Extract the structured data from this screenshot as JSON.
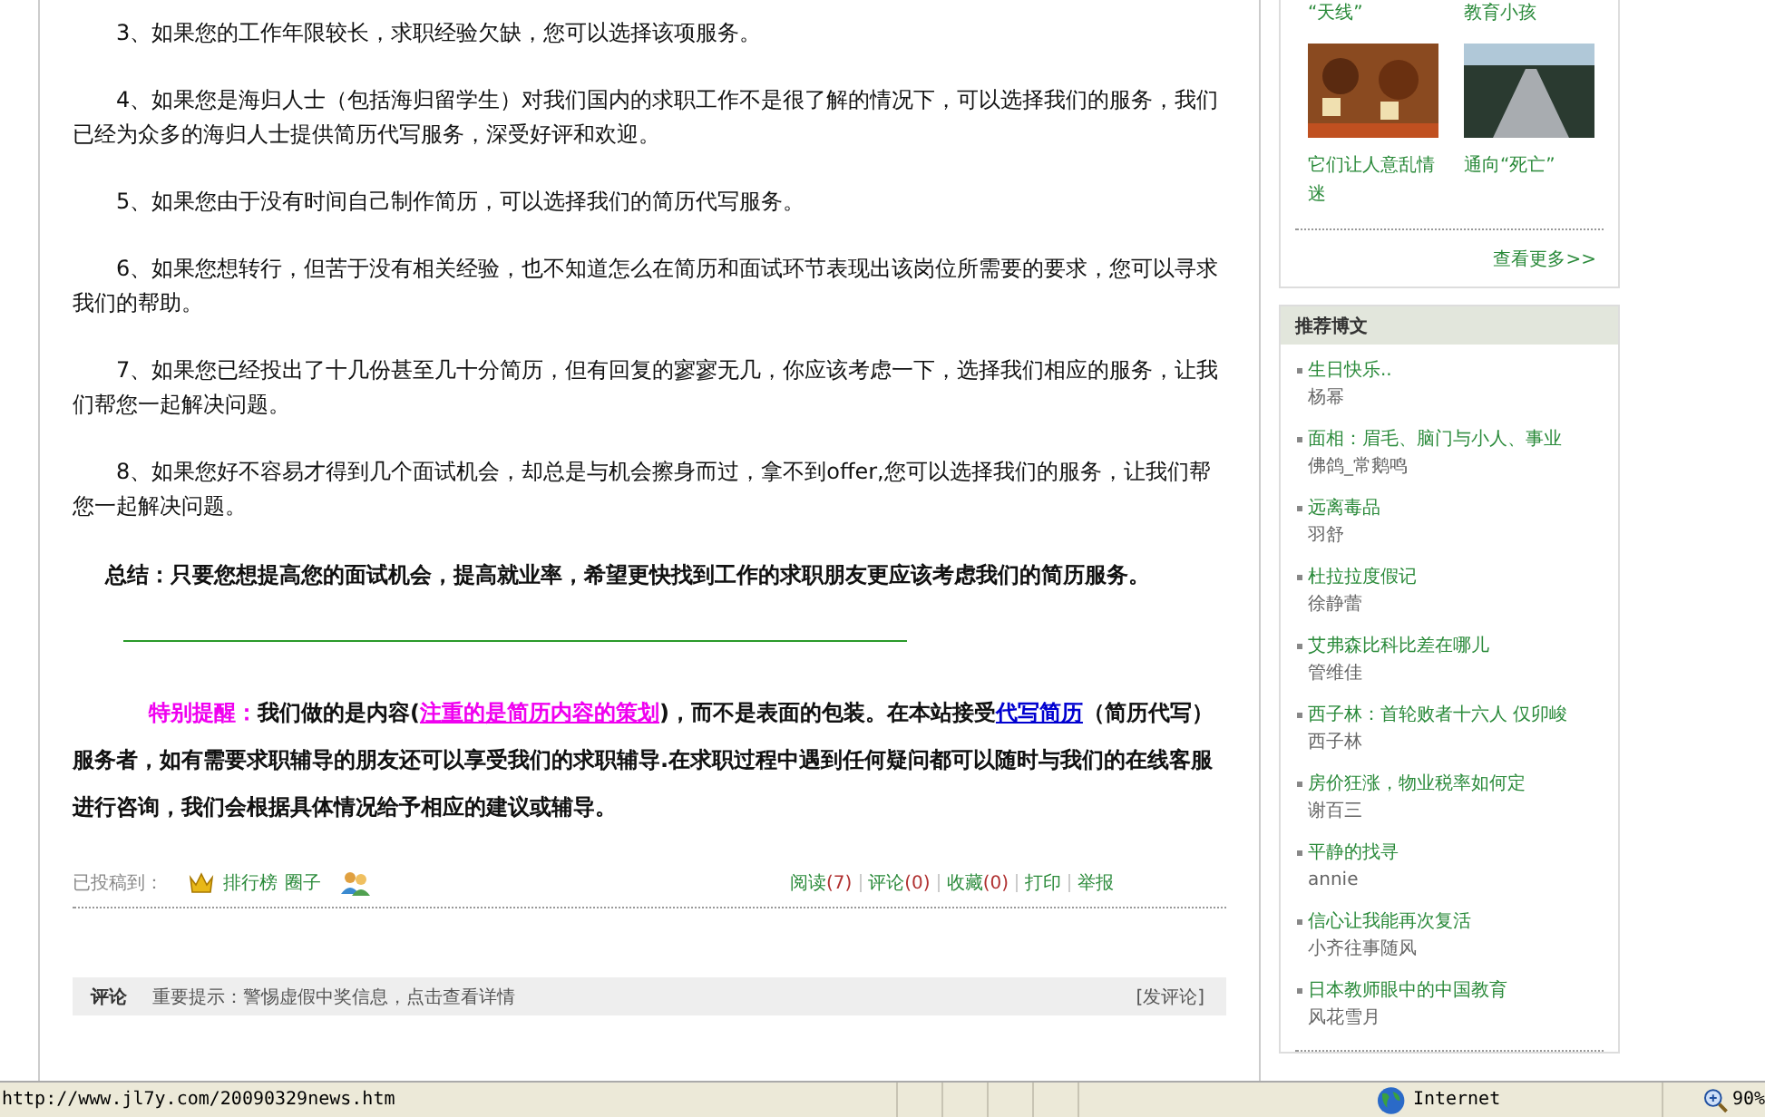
{
  "article": {
    "paragraphs": [
      [
        "3、如果您的工作年限较长，求职经验欠缺，您可以选择该项服务。"
      ],
      [
        "4、如果您是海归人士（包括海归留学生）对我们国内的求职工作不是很了解的情况下，可以选择我们的服务，我们已经为众多的海归人士提供简历代写服务，深受好评和欢迎。"
      ],
      [
        "5、如果您由于没有时间自己制作简历，可以选择我们的简历代写服务。"
      ],
      [
        "6、如果您想转行，但苦于没有相关经验，也不知道怎么在简历和面试环节表现出该岗位所需要的要求，您可以寻求我们的帮助。"
      ],
      [
        "7、如果您已经投出了十几份甚至几十分简历，但有回复的寥寥无几，你应该考虑一下，选择我们相应的服务，让我们帮您一起解决问题。"
      ],
      [
        "8、如果您好不容易才得到几个面试机会，却总是与机会擦身而过，拿不到offer,您可以选择我们的服务，让我们帮您一起解决问题。"
      ]
    ],
    "summary": "总结：只要您想提高您的面试机会，提高就业率，希望更快找到工作的求职朋友更应该考虑我们的简历服务。",
    "notice": [
      {
        "kind": "label",
        "text": "特别提醒："
      },
      {
        "kind": "text",
        "text": "我们做的是内容("
      },
      {
        "kind": "accent_link",
        "text": "注重的是简历内容的策划"
      },
      {
        "kind": "text",
        "text": ")，而不是表面的包装。在本站接受"
      },
      {
        "kind": "link",
        "text": "代写简历"
      },
      {
        "kind": "text",
        "text": "（简历代写）服务者，如有需要求职辅导的朋友还可以享受我们的求职辅导.在求职过程中遇到任何疑问都可以随时与我们的在线客服进行咨询，我们会根据具体情况给予相应的建议或辅导。"
      }
    ],
    "posted_label": "已投稿到：",
    "posted_to": [
      "排行榜",
      "圈子"
    ],
    "actions": [
      {
        "label": "阅读",
        "count": "(7)"
      },
      {
        "label": "评论",
        "count": "(0)"
      },
      {
        "label": "收藏",
        "count": "(0)"
      },
      {
        "label": "打印"
      },
      {
        "label": "举报"
      }
    ]
  },
  "comments": {
    "title": "评论",
    "notice": "重要提示：警惕虚假中奖信息，点击查看详情",
    "button": "[发评论]"
  },
  "sidebar": {
    "photo_box": {
      "top_captions": [
        "“天线”",
        "教育小孩"
      ],
      "photos": [
        {
          "kind": "food",
          "caption": "它们让人意乱情迷"
        },
        {
          "kind": "road",
          "caption": "通向“死亡”"
        }
      ],
      "more": "查看更多>>"
    },
    "recommended": {
      "title": "推荐博文",
      "items": [
        {
          "title": "生日快乐..",
          "author": "杨幂"
        },
        {
          "title": "面相：眉毛、脑门与小人、事业",
          "author": "佛鸽_常鹅鸣"
        },
        {
          "title": "远离毒品",
          "author": "羽舒"
        },
        {
          "title": "杜拉拉度假记",
          "author": "徐静蕾"
        },
        {
          "title": "艾弗森比科比差在哪儿",
          "author": "管维佳"
        },
        {
          "title": "西子林：首轮败者十六人 仅卯峻",
          "author": "西子林"
        },
        {
          "title": "房价狂涨，物业税率如何定",
          "author": "谢百三"
        },
        {
          "title": "平静的找寻",
          "author": "annie"
        },
        {
          "title": "信心让我能再次复活",
          "author": "小齐往事随风"
        },
        {
          "title": "日本教师眼中的中国教育",
          "author": "风花雪月"
        }
      ]
    }
  },
  "status_bar": {
    "url": "http://www.jl7y.com/20090329news.htm",
    "zone": "Internet",
    "zoom": "90%"
  }
}
